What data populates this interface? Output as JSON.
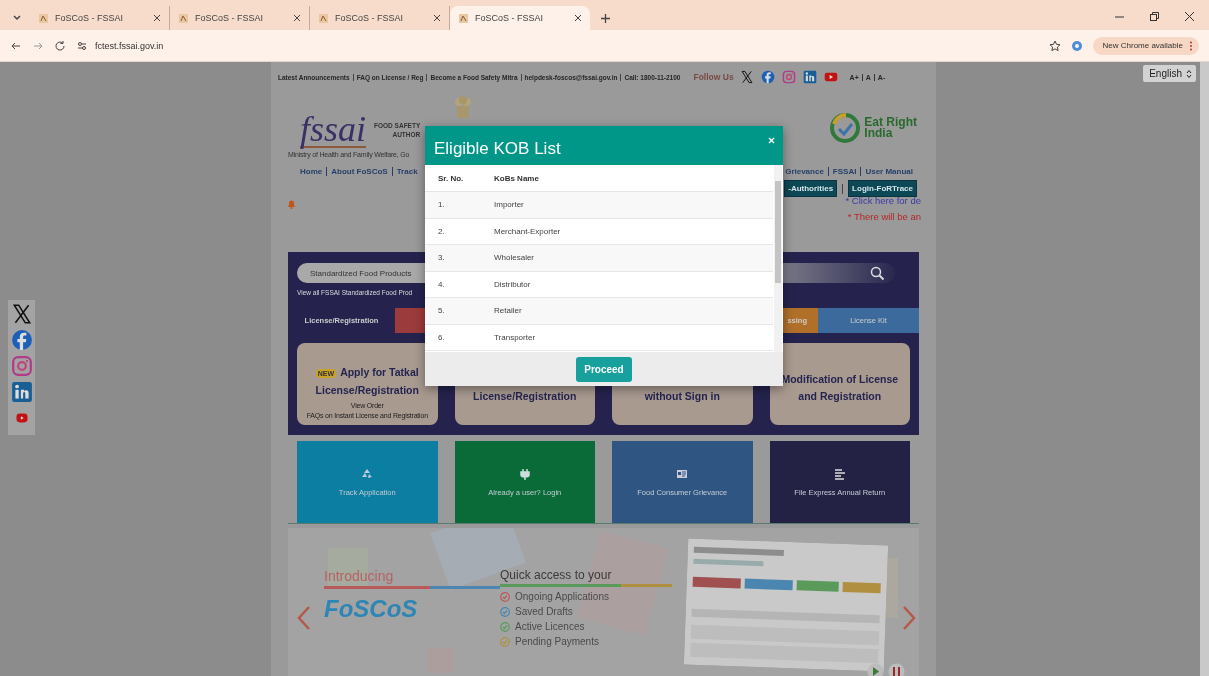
{
  "browser": {
    "tabs": [
      {
        "title": "FoSCoS - FSSAI",
        "selected": false
      },
      {
        "title": "FoSCoS - FSSAI",
        "selected": false
      },
      {
        "title": "FoSCoS - FSSAI",
        "selected": false
      },
      {
        "title": "FoSCoS - FSSAI",
        "selected": true
      }
    ],
    "url": "fctest.fssai.gov.in",
    "update_button": "New Chrome available"
  },
  "language_select": {
    "value": "English"
  },
  "top_links": [
    "Latest Announcements",
    "FAQ on License / Reg",
    "Become a Food Safety Mitra",
    "helpdesk-foscos@fssai.gov.in",
    "Call: 1800-11-2100"
  ],
  "follow_label": "Follow Us",
  "font_sizes": [
    "A+",
    "A",
    "A-"
  ],
  "header": {
    "logo_text": "fssai",
    "org_name_lines": [
      "FOOD SAFETY",
      "AUTHOR"
    ],
    "ministry": "Ministry of Health and Family Welfare, Go",
    "eat_right": [
      "Eat Right",
      "India"
    ]
  },
  "nav_left": [
    "Home",
    "About FoSCoS",
    "Track"
  ],
  "nav_right": [
    "Grievance",
    "FSSAI",
    "User Manual"
  ],
  "nav_buttons": [
    "-Authorities",
    "Login-FoRTrace"
  ],
  "notices": [
    {
      "text": "* Click here for de",
      "kind": "info"
    },
    {
      "text": "* There will be an",
      "kind": "alert"
    }
  ],
  "search": {
    "value": "Standardized Food Products",
    "link": "View all FSSAI Standardized Food Prod"
  },
  "service_tabs": [
    {
      "label": "License/Registration",
      "color": "#25234d"
    },
    {
      "color": "#9c3b3b"
    },
    {
      "label": "ssing",
      "color": "#b0702a"
    },
    {
      "label": "License Kit",
      "color": "#3c6a9c"
    }
  ],
  "cards": [
    {
      "title": "Apply for Tatkal License/Registration",
      "badge": "NEW",
      "links": [
        "View Order",
        "FAQs on Instant License and Registration"
      ]
    },
    {
      "title": "License/Registration"
    },
    {
      "title": "without Sign in"
    },
    {
      "title": "Modification of License and Registration"
    }
  ],
  "tiles": [
    {
      "label": "Track Application",
      "color": "#0b7ea1"
    },
    {
      "label": "Already a user? Login",
      "color": "#0a6b38"
    },
    {
      "label": "Food Consumer Grievance",
      "color": "#2f5583"
    },
    {
      "label": "File Express Annual Return",
      "color": "#242244"
    }
  ],
  "banner": {
    "intro": "Introducing",
    "brand": "FoSCoS",
    "heading": "Quick access to your",
    "items": [
      {
        "text": "Ongoing Applications",
        "color": "#b85a5a"
      },
      {
        "text": "Saved Drafts",
        "color": "#4a86b0"
      },
      {
        "text": "Active Licences",
        "color": "#5a9a5a"
      },
      {
        "text": "Pending Payments",
        "color": "#b09040"
      }
    ]
  },
  "modal": {
    "title": "Eligible KOB List",
    "columns": [
      "Sr. No.",
      "KoBs Name"
    ],
    "rows": [
      [
        "1.",
        "Importer"
      ],
      [
        "2.",
        "Merchant-Exporter"
      ],
      [
        "3.",
        "Wholesaler"
      ],
      [
        "4.",
        "Distributor"
      ],
      [
        "5.",
        "Retailer"
      ],
      [
        "6.",
        "Transporter"
      ]
    ],
    "button": "Proceed"
  }
}
